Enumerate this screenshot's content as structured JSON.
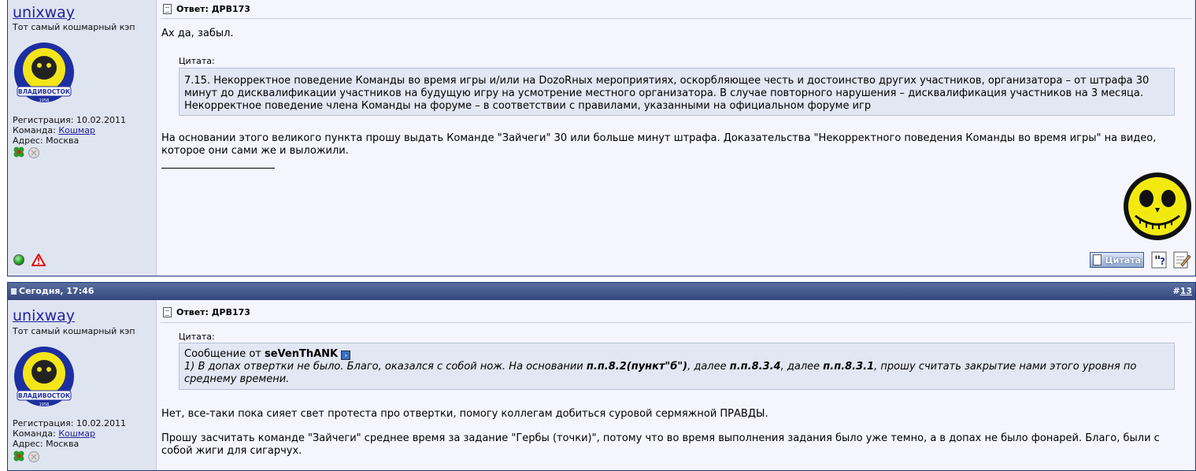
{
  "post1": {
    "author": {
      "username": "unixway",
      "usertitle": "Тот самый кошмарный кэп",
      "reg_label": "Регистрация:",
      "reg_date": "10.02.2011",
      "team_label": "Команда:",
      "team_name": "Кошмар",
      "addr_label": "Адрес:",
      "addr_value": "Москва",
      "avatar_text": "ВЛАДИВОСТОК",
      "avatar_year": "1958"
    },
    "title": "Ответ: ДРВ173",
    "text1": "Ах да, забыл.",
    "quote_label": "Цитата:",
    "quote_text": "7.15. Некорректное поведение Команды во время игры и/или на DozoRных мероприятиях, оскорбляющее честь и достоинство других участников, организатора – от штрафа 30 минут до дисквалификации участников на будущую игру на усмотрение местного организатора. В случае повторного нарушения – дисквалификация участников на 3 месяца. Некорректное поведение члена Команды на форуме – в соответствии с правилами, указанными на официальном форуме игр",
    "text2": "На основании этого великого пункта прошу выдать Команде \"Зайчеги\" 30 или больше минут штрафа. Доказательства \"Некорректного поведения Команды во время игры\" на видео, которое они сами же и выложили.",
    "quote_button": "Цитата"
  },
  "post2": {
    "date": "Сегодня, 17:46",
    "number_prefix": "#",
    "number": "13",
    "author": {
      "username": "unixway",
      "usertitle": "Тот самый кошмарный кэп",
      "reg_label": "Регистрация:",
      "reg_date": "10.02.2011",
      "team_label": "Команда:",
      "team_name": "Кошмар",
      "addr_label": "Адрес:",
      "addr_value": "Москва",
      "avatar_text": "ВЛАДИВОСТОК",
      "avatar_year": "1958"
    },
    "title": "Ответ: ДРВ173",
    "quote_label": "Цитата:",
    "quote_from_prefix": "Сообщение от",
    "quote_author": "seVenThANK",
    "quote_parts": [
      "1) В допах отвертки не было. Благо, оказался с собой нож. На основании ",
      "п.п.8.2(пункт\"б\")",
      ", далее ",
      "п.п.8.3.4",
      ", далее ",
      "п.п.8.3.1",
      ", прошу считать закрытие нами этого уровня по среднему времени."
    ],
    "text1": "Нет, все-таки пока сияет свет протеста про отвертки, помогу коллегам добиться суровой сермяжной ПРАВДЫ.",
    "text2": "Прошу засчитать команде \"Зайчеги\" среднее время за задание \"Гербы (точки)\", потому что во время выполнения задания было уже темно, а в допах не было фонарей. Благо, были с собой жиги для сигарчух."
  },
  "colors": {
    "header_bar": "#33477d",
    "sidebar": "#dfe4f1",
    "post_bg": "#f5f5ff",
    "quote_bg": "#e3e7f3",
    "link": "#22229c"
  }
}
